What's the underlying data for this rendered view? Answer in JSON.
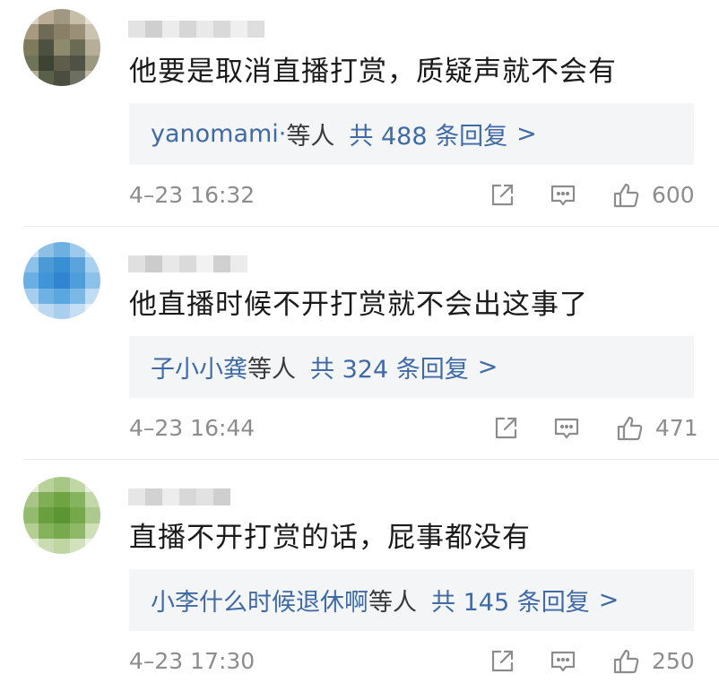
{
  "comments": [
    {
      "text": "他要是取消直播打赏，质疑声就不会有",
      "reply_names": "yanomami·",
      "reply_suffix": "等人",
      "reply_total": "共 488 条回复",
      "reply_chevron": ">",
      "time": "4–23 16:32",
      "likes": "600"
    },
    {
      "text": "他直播时候不开打赏就不会出这事了",
      "reply_names": "子小小龚",
      "reply_suffix": "等人",
      "reply_total": "共 324 条回复",
      "reply_chevron": ">",
      "time": "4–23 16:44",
      "likes": "471"
    },
    {
      "text": "直播不开打赏的话，屁事都没有",
      "reply_names": "小李什么时候退休啊",
      "reply_suffix": "等人",
      "reply_total": "共 145 条回复",
      "reply_chevron": ">",
      "time": "4–23 17:30",
      "likes": "250"
    }
  ],
  "icons": {
    "share": "share-icon",
    "comment": "comment-icon",
    "like": "thumbs-up-icon"
  },
  "colors": {
    "link": "#3f6aa5",
    "meta": "#8c8c8c",
    "reply_bg": "#f4f5f7"
  }
}
